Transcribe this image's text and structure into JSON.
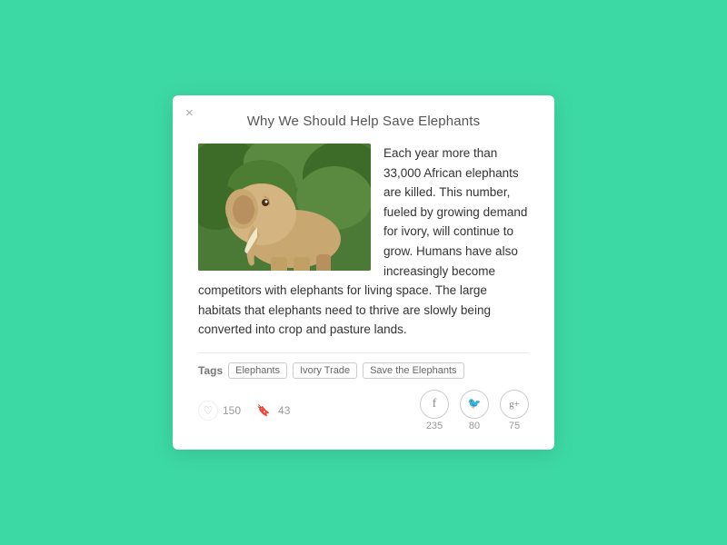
{
  "modal": {
    "title": "Why We Should Help Save Elephants",
    "close_label": "×",
    "body_text": "Each year more than 33,000 African elephants are killed. This number, fueled by growing demand for ivory, will continue to grow. Humans have also increasingly become competitors with elephants for living space. The large habitats that elephants need to thrive are slowly being converted into crop and pasture lands.",
    "tags_label": "Tags",
    "tags": [
      "Elephants",
      "Ivory Trade",
      "Save the Elephants"
    ],
    "likes_count": "150",
    "bookmarks_count": "43",
    "social": [
      {
        "name": "facebook",
        "symbol": "f",
        "count": "235"
      },
      {
        "name": "twitter",
        "symbol": "🐦",
        "count": "80"
      },
      {
        "name": "googleplus",
        "symbol": "g+",
        "count": "75"
      }
    ]
  },
  "colors": {
    "background": "#3dd9a4",
    "modal_bg": "#ffffff",
    "accent": "#3dd9a4"
  }
}
